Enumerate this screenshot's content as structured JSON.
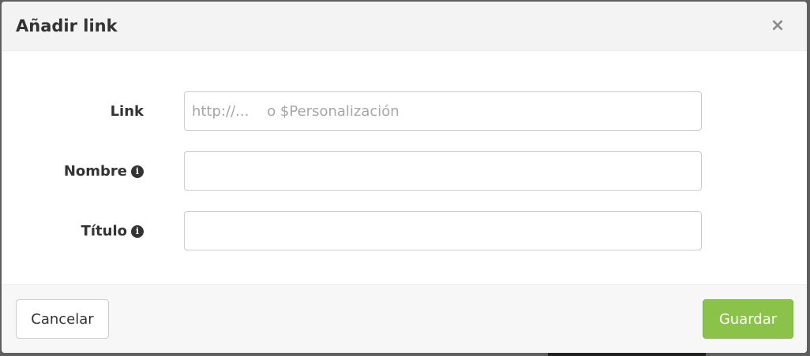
{
  "dialog": {
    "title": "Añadir link",
    "close_glyph": "×"
  },
  "form": {
    "link": {
      "label": "Link",
      "placeholder": "http://...    o $Personalización",
      "value": ""
    },
    "name": {
      "label": "Nombre",
      "info_icon": "info-circle-icon",
      "value": ""
    },
    "title": {
      "label": "Título",
      "info_icon": "info-circle-icon",
      "value": ""
    }
  },
  "footer": {
    "cancel_label": "Cancelar",
    "save_label": "Guardar"
  },
  "colors": {
    "save_button": "#8bc34a",
    "header_bg": "#f3f3f3"
  }
}
